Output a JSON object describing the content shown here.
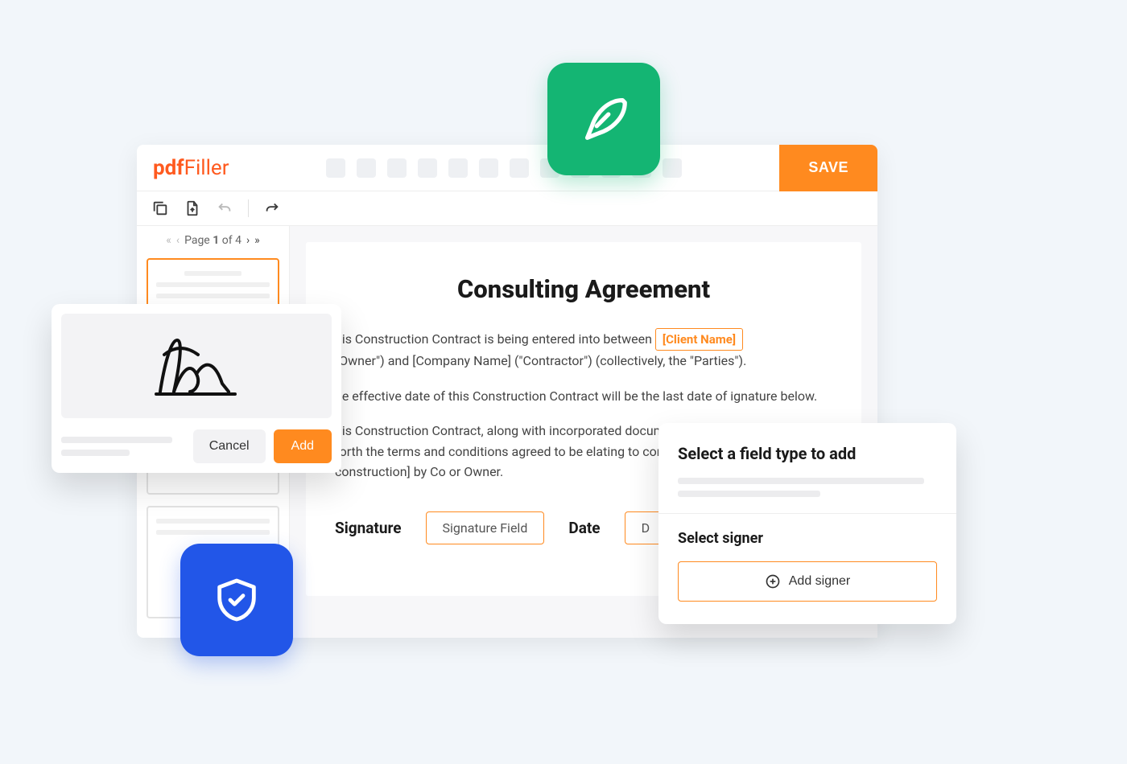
{
  "brand": {
    "name_a": "pdf",
    "name_b": "Filler"
  },
  "header": {
    "save_label": "SAVE"
  },
  "pager": {
    "prefix": "Page ",
    "current": "1",
    "of_label": " of ",
    "total": "4"
  },
  "doc": {
    "title": "Consulting Agreement",
    "para1_a": "his Construction Contract is being entered into between ",
    "token1": "[Client Name]",
    "para1_b": "\"Owner\") and  [Company Name]  (\"Contractor\") (collectively, the \"Parties\").",
    "para2": "he effective date of this Construction Contract will be the last date of ignature below.",
    "para3": "his Construction Contract, along with incorporated documents referenced erein, sets forth the terms and conditions agreed to be elating to construction of [type of construction] by Co or Owner.",
    "sig_label": "Signature",
    "sig_field": "Signature Field",
    "date_label": "Date",
    "date_field": "D"
  },
  "sig_popup": {
    "cancel": "Cancel",
    "add": "Add"
  },
  "signer_popup": {
    "title": "Select a field type to add",
    "subtitle": "Select signer",
    "add_signer": "Add signer"
  }
}
